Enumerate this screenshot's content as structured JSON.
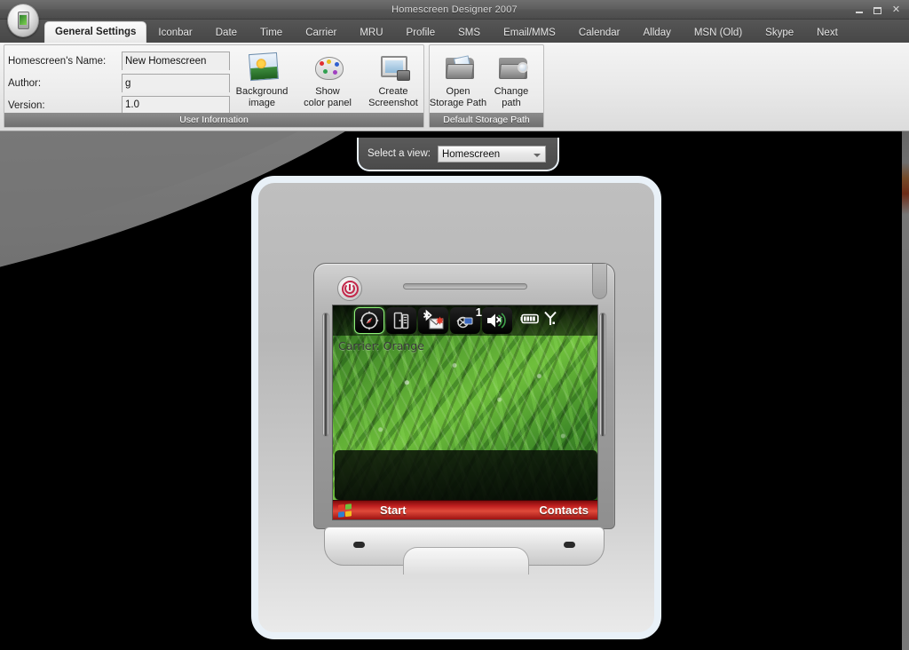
{
  "window": {
    "title": "Homescreen Designer 2007",
    "app_icon": "device-orb-icon",
    "controls": {
      "minimize": "minimize-button",
      "maximize": "maximize-button",
      "close": "✕"
    }
  },
  "tabs": [
    {
      "label": "General Settings",
      "active": true
    },
    {
      "label": "Iconbar",
      "active": false
    },
    {
      "label": "Date",
      "active": false
    },
    {
      "label": "Time",
      "active": false
    },
    {
      "label": "Carrier",
      "active": false
    },
    {
      "label": "MRU",
      "active": false
    },
    {
      "label": "Profile",
      "active": false
    },
    {
      "label": "SMS",
      "active": false
    },
    {
      "label": "Email/MMS",
      "active": false
    },
    {
      "label": "Calendar",
      "active": false
    },
    {
      "label": "Allday",
      "active": false
    },
    {
      "label": "MSN (Old)",
      "active": false
    },
    {
      "label": "Skype",
      "active": false
    },
    {
      "label": "Next",
      "active": false
    }
  ],
  "ribbon": {
    "user_information": {
      "group_title": "User Information",
      "fields": [
        {
          "label": "Homescreen's Name:",
          "value": "New Homescreen"
        },
        {
          "label": "Author:",
          "value": "g"
        },
        {
          "label": "Version:",
          "value": "1.0"
        }
      ],
      "buttons": [
        {
          "line1": "Background",
          "line2": "image",
          "icon": "picture-icon"
        },
        {
          "line1": "Show",
          "line2": "color panel",
          "icon": "palette-icon"
        },
        {
          "line1": "Create",
          "line2": "Screenshot",
          "icon": "screenshot-icon"
        }
      ]
    },
    "default_storage_path": {
      "group_title": "Default Storage Path",
      "buttons": [
        {
          "line1": "Open",
          "line2": "Storage Path",
          "icon": "open-folder-icon"
        },
        {
          "line1": "Change",
          "line2": "path",
          "icon": "change-folder-icon"
        }
      ]
    }
  },
  "view_selector": {
    "label": "Select a view:",
    "selected": "Homescreen",
    "options": [
      "Homescreen"
    ]
  },
  "preview": {
    "device": {
      "power_button": "power-icon",
      "speaker": "earpiece-speaker",
      "antenna": "antenna-stub",
      "side_button_left": "volume-rocker-left",
      "side_button_right": "volume-rocker-right"
    },
    "screen": {
      "iconbar": [
        {
          "name": "compass-icon",
          "selected": true,
          "badge": ""
        },
        {
          "name": "doors-icon",
          "selected": false,
          "badge": ""
        },
        {
          "name": "bluetooth-message-icon",
          "selected": false,
          "badge": ""
        },
        {
          "name": "missed-call-icon",
          "selected": false,
          "badge": "1"
        },
        {
          "name": "mute-volume-icon",
          "selected": false,
          "badge": ""
        }
      ],
      "status": [
        {
          "name": "battery-icon"
        },
        {
          "name": "signal-icon"
        }
      ],
      "carrier_text": "Carrier: Orange",
      "wallpaper": "green-grass-dew",
      "taskbar": {
        "start_icon": "windows-flag-icon",
        "left_label": "Start",
        "right_label": "Contacts"
      }
    }
  },
  "colors": {
    "titlebar": "#565656",
    "tabstrip": "#4e4e4e",
    "ribbon_bg": "#e8e8e8",
    "group_title_bg": "#6f6f6f",
    "panel_border": "#e9f1f8",
    "canvas_bg": "#000000",
    "swoosh": "#7c7c7c",
    "taskbar_red": "#c02020",
    "power_red": "#c3284a",
    "selection_green": "#8ef07a"
  }
}
